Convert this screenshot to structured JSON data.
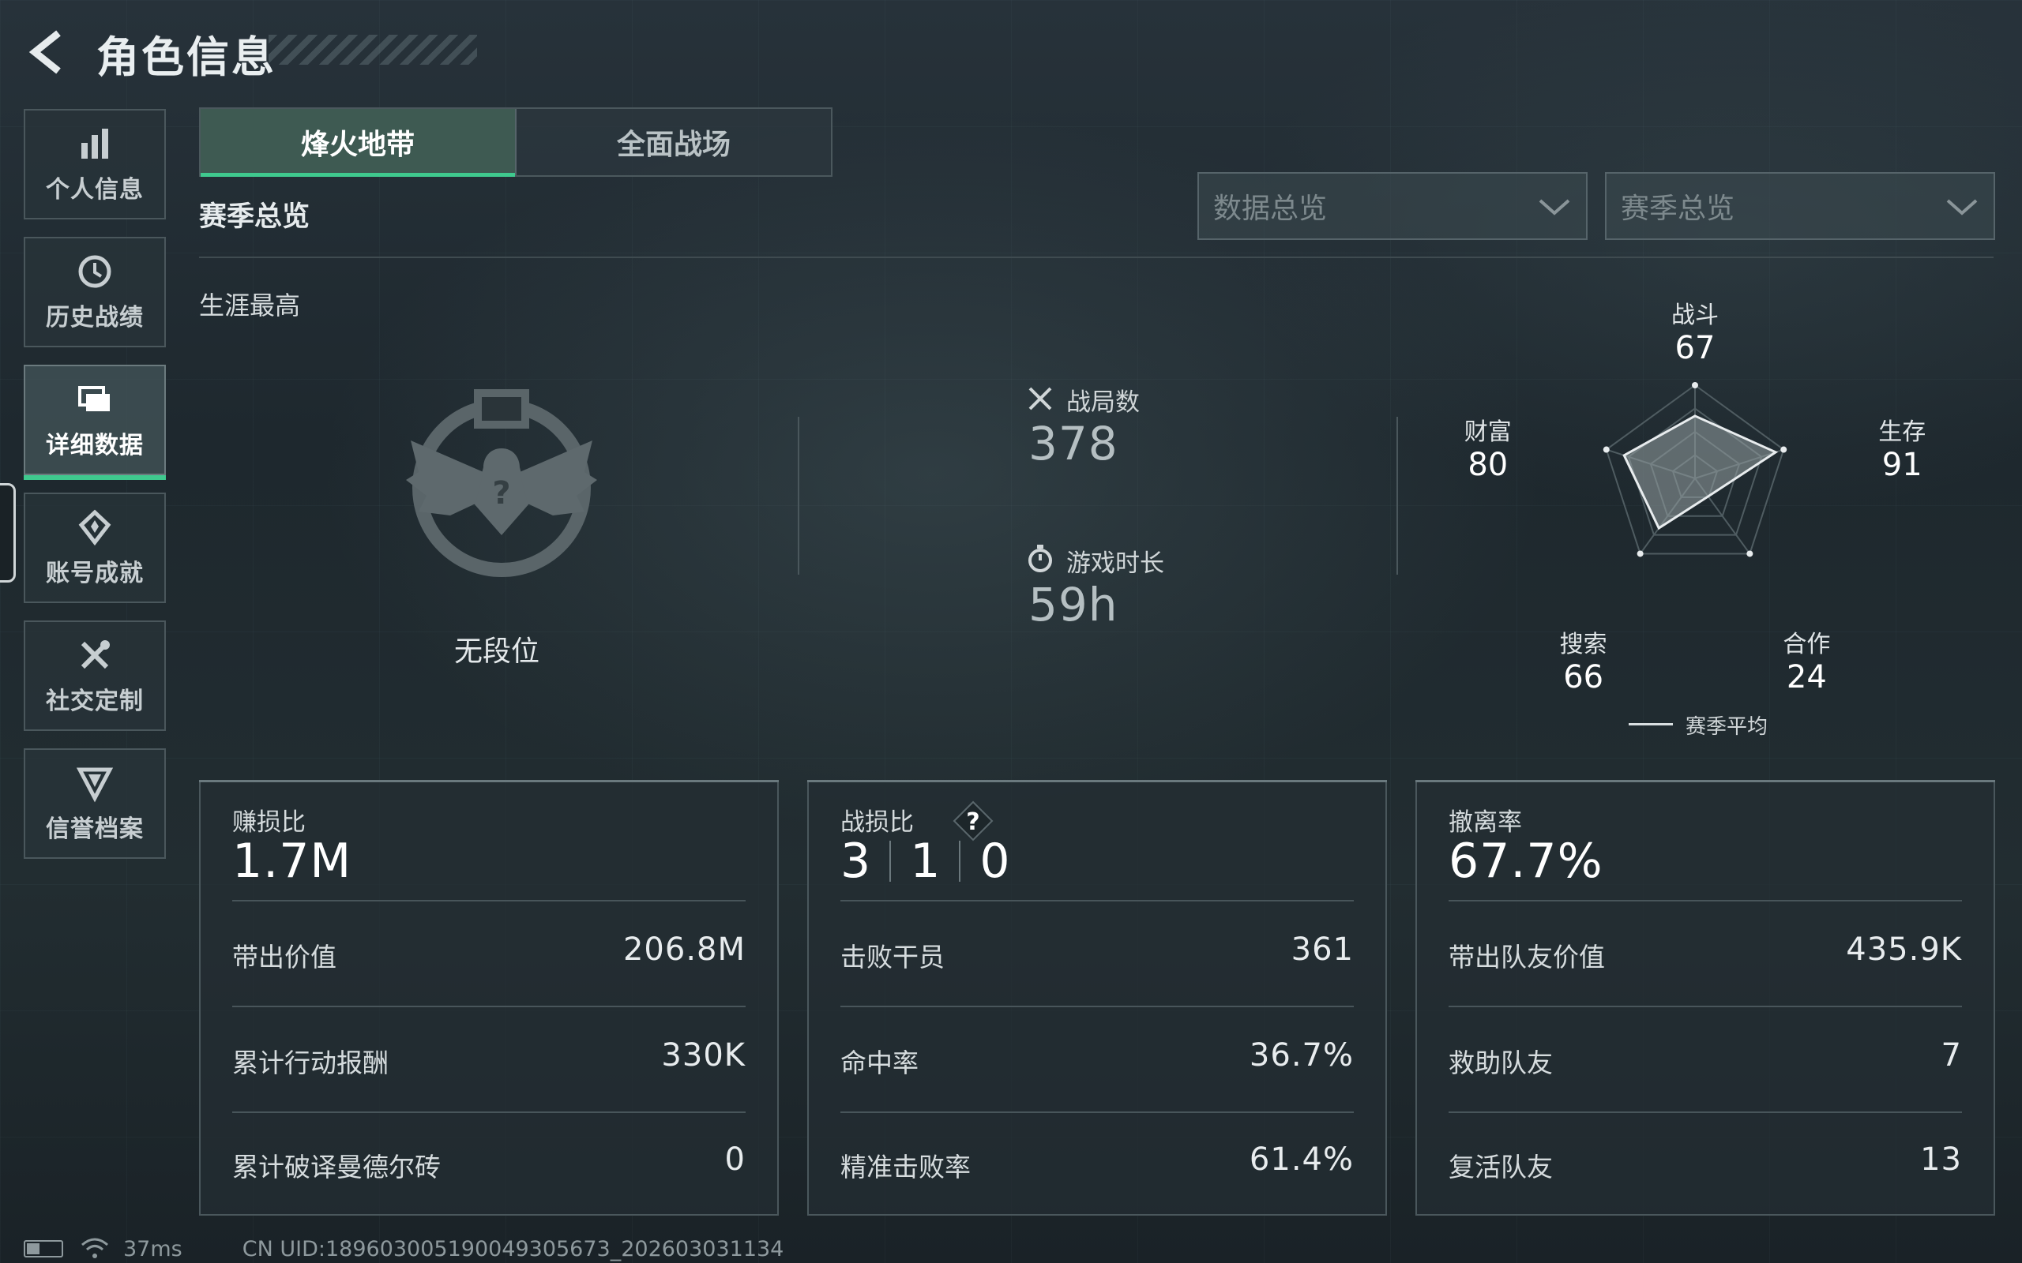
{
  "header": {
    "title": "角色信息"
  },
  "sidebar": {
    "items": [
      {
        "label": "个人信息",
        "icon": "bar-chart-icon",
        "active": false
      },
      {
        "label": "历史战绩",
        "icon": "history-clock-icon",
        "active": false
      },
      {
        "label": "详细数据",
        "icon": "folder-icon",
        "active": true
      },
      {
        "label": "账号成就",
        "icon": "achievement-icon",
        "active": false
      },
      {
        "label": "社交定制",
        "icon": "tools-icon",
        "active": false
      },
      {
        "label": "信誉档案",
        "icon": "credit-shield-icon",
        "active": false
      }
    ]
  },
  "tabs": [
    {
      "label": "烽火地带",
      "active": true
    },
    {
      "label": "全面战场",
      "active": false
    }
  ],
  "section": {
    "title": "赛季总览",
    "career_label": "生涯最高"
  },
  "filters": {
    "data_dropdown": "数据总览",
    "season_dropdown": "赛季总览"
  },
  "rank": {
    "label": "无段位"
  },
  "stats": {
    "matches_label": "战局数",
    "matches_value": "378",
    "playtime_label": "游戏时长",
    "playtime_value": "59h"
  },
  "radar": {
    "axes": [
      {
        "label": "战斗",
        "value": "67",
        "score": 67
      },
      {
        "label": "生存",
        "value": "91",
        "score": 91
      },
      {
        "label": "合作",
        "value": "24",
        "score": 24
      },
      {
        "label": "搜索",
        "value": "66",
        "score": 66
      },
      {
        "label": "财富",
        "value": "80",
        "score": 80
      }
    ],
    "legend": "赛季平均"
  },
  "panels": {
    "profit": {
      "title": "赚损比",
      "value": "1.7M",
      "rows": [
        {
          "label": "带出价值",
          "value": "206.8M"
        },
        {
          "label": "累计行动报酬",
          "value": "330K"
        },
        {
          "label": "累计破译曼德尔砖",
          "value": "0"
        }
      ]
    },
    "combat": {
      "title": "战损比",
      "kd": [
        "3",
        "1",
        "0"
      ],
      "rows": [
        {
          "label": "击败干员",
          "value": "361"
        },
        {
          "label": "命中率",
          "value": "36.7%"
        },
        {
          "label": "精准击败率",
          "value": "61.4%"
        }
      ]
    },
    "extract": {
      "title": "撤离率",
      "value": "67.7%",
      "rows": [
        {
          "label": "带出队友价值",
          "value": "435.9K"
        },
        {
          "label": "救助队友",
          "value": "7"
        },
        {
          "label": "复活队友",
          "value": "13"
        }
      ]
    }
  },
  "footer": {
    "ping": "37ms",
    "uid": "CN UID:18960300519004930567​3_202603031134"
  },
  "colors": {
    "accent": "#3fc98e",
    "panel_border": "#4a575c"
  }
}
